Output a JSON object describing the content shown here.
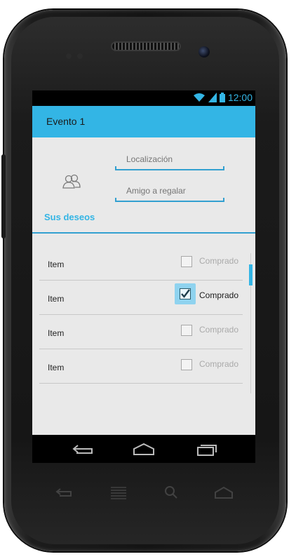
{
  "status_bar": {
    "time": "12:00",
    "icons": [
      "wifi-icon",
      "signal-icon",
      "battery-icon"
    ],
    "accent_color": "#33b5e5"
  },
  "action_bar": {
    "title": "Evento 1",
    "background": "#33b5e5"
  },
  "form": {
    "location_placeholder": "Localización",
    "friend_placeholder": "Amigo a regalar",
    "contact_icon": "contacts-icon"
  },
  "section": {
    "title": "Sus deseos"
  },
  "list": {
    "items": [
      {
        "label": "Item",
        "checkbox_label": "Comprado",
        "checked": false
      },
      {
        "label": "Item",
        "checkbox_label": "Comprado",
        "checked": true
      },
      {
        "label": "Item",
        "checkbox_label": "Comprado",
        "checked": false
      },
      {
        "label": "Item",
        "checkbox_label": "Comprado",
        "checked": false
      }
    ]
  },
  "nav_bar": {
    "buttons": [
      "back-icon",
      "home-icon",
      "recent-apps-icon"
    ]
  },
  "hardware_keys": [
    "back-key-icon",
    "menu-key-icon",
    "search-key-icon",
    "home-key-icon"
  ]
}
